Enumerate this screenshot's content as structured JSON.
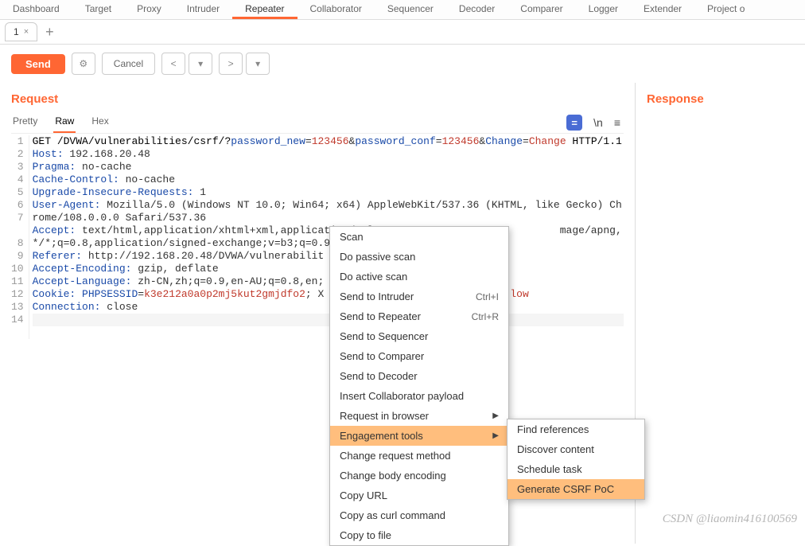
{
  "topTabs": {
    "t0": "Dashboard",
    "t1": "Target",
    "t2": "Proxy",
    "t3": "Intruder",
    "t4": "Repeater",
    "t5": "Collaborator",
    "t6": "Sequencer",
    "t7": "Decoder",
    "t8": "Comparer",
    "t9": "Logger",
    "t10": "Extender",
    "t11": "Project o"
  },
  "subTab": {
    "label": "1",
    "close": "×",
    "add": "+"
  },
  "actions": {
    "send": "Send",
    "cancel": "Cancel",
    "prev": "<",
    "next": ">",
    "gear": "⚙",
    "menu": "▾"
  },
  "panels": {
    "request": "Request",
    "response": "Response"
  },
  "viewTabs": {
    "pretty": "Pretty",
    "raw": "Raw",
    "hex": "Hex"
  },
  "viewIcons": {
    "equals": "=",
    "newline": "\\n",
    "hamburger": "≡"
  },
  "gutter": {
    "l1": "1",
    "l2": "2",
    "l3": "3",
    "l4": "4",
    "l5": "5",
    "l6": "6",
    "l7": "7",
    "l8": "8",
    "l9": "9",
    "l10": "10",
    "l11": "11",
    "l12": "12",
    "l13": "13",
    "l14": "14"
  },
  "http": {
    "method": "GET ",
    "path": "/DVWA/vulnerabilities/csrf/?",
    "p1k": "password_new",
    "eq": "=",
    "amp": "&",
    "p1v": "123456",
    "p2k": "password_conf",
    "p2v": "123456",
    "p3k": "Change",
    "p3v": "Change",
    "proto": " HTTP/1.1",
    "host_k": "Host:",
    "host_v": " 192.168.20.48",
    "pragma_k": "Pragma:",
    "pragma_v": " no-cache",
    "cache_k": "Cache-Control:",
    "cache_v": " no-cache",
    "uir_k": "Upgrade-Insecure-Requests:",
    "uir_v": " 1",
    "ua_k": "User-Agent:",
    "ua_v": " Mozilla/5.0 (Windows NT 10.0; Win64; x64) AppleWebKit/537.36 (KHTML, like Gecko) Chrome/108.0.0.0 Safari/537.36",
    "accept_k": "Accept:",
    "accept_v": " text/html,application/xhtml+xml,application/xml",
    "accept_tail1": "mage/apng,*/*;q=0.8,application/signed-exchange;v=b3;q=0.9",
    "referer_k": "Referer:",
    "referer_v": " http://192.168.20.48/DVWA/vulnerabilit",
    "ae_k": "Accept-Encoding:",
    "ae_v": " gzip, deflate",
    "al_k": "Accept-Language:",
    "al_v": " zh-CN,zh;q=0.9,en-AU;q=0.8,en;",
    "cookie_k": "Cookie:",
    "cookie_sp": " ",
    "cookie_p1": "PHPSESSID",
    "cookie_eq": "=",
    "cookie_v1": "k3e212a0a0p2mj5kut2gmjdfo2",
    "cookie_sep": "; X",
    "cookie_tail": "low",
    "conn_k": "Connection:",
    "conn_v": " close"
  },
  "ctx": {
    "scan": "Scan",
    "passive": "Do passive scan",
    "active": "Do active scan",
    "intruder": "Send to Intruder",
    "intruder_sc": "Ctrl+I",
    "repeater": "Send to Repeater",
    "repeater_sc": "Ctrl+R",
    "sequencer": "Send to Sequencer",
    "comparer": "Send to Comparer",
    "decoder": "Send to Decoder",
    "collab": "Insert Collaborator payload",
    "browser": "Request in browser",
    "engage": "Engagement tools",
    "method": "Change request method",
    "body": "Change body encoding",
    "copyurl": "Copy URL",
    "curl": "Copy as curl command",
    "file": "Copy to file"
  },
  "sub": {
    "find": "Find references",
    "discover": "Discover content",
    "schedule": "Schedule task",
    "csrf": "Generate CSRF PoC"
  },
  "watermark": "CSDN @liaomin416100569"
}
